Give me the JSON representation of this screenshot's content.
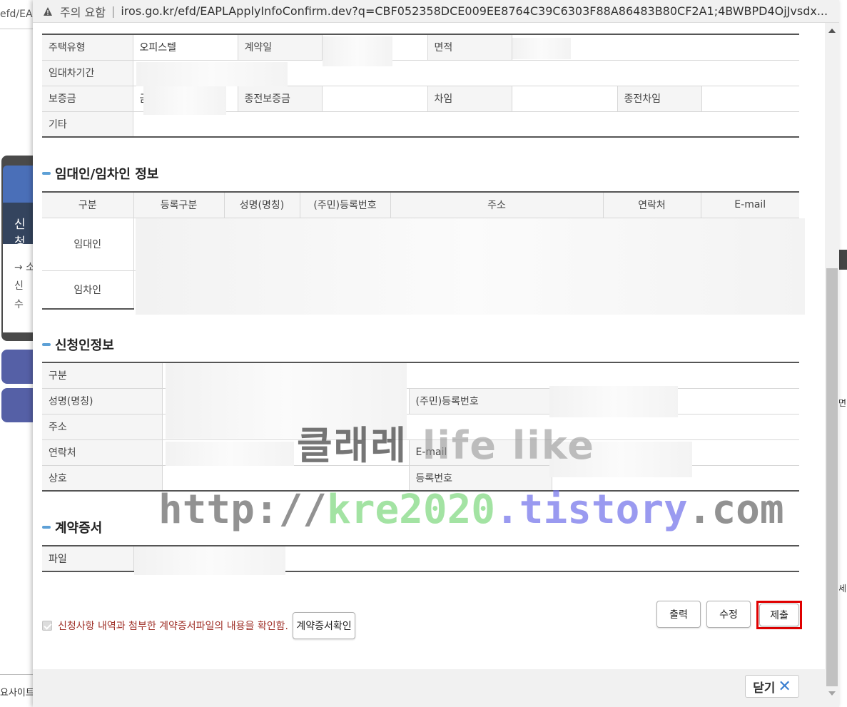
{
  "background": {
    "url_fragment": "efd/EA",
    "side_label": "신청",
    "side_items": [
      "→ 소",
      "신",
      "수"
    ],
    "bottom_text": "요사이트",
    "right_text_1": "면",
    "right_text_2": "세"
  },
  "browser": {
    "warning_text": "주의 요함",
    "url": "iros.go.kr/efd/EAPLApplyInfoConfirm.dev?q=CBF052358DCE009EE8764C39C6303F88A86483B80CF2A1;4BWBPD4OjJvsdx..."
  },
  "contract_table": {
    "housing_type_label": "주택유형",
    "housing_type_value": "오피스텔",
    "contract_date_label": "계약일",
    "area_label": "면적",
    "lease_period_label": "임대차기간",
    "deposit_label": "보증금",
    "deposit_value_partial": "금",
    "prev_deposit_label": "종전보증금",
    "rent_label": "차임",
    "prev_rent_label": "종전차임",
    "etc_label": "기타"
  },
  "parties": {
    "title": "임대인/임차인 정보",
    "headers": [
      "구분",
      "등록구분",
      "성명(명칭)",
      "(주민)등록번호",
      "주소",
      "연락처",
      "E-mail"
    ],
    "rows": [
      "임대인",
      "임차인"
    ]
  },
  "applicant": {
    "title": "신청인정보",
    "category_label": "구분",
    "name_label": "성명(명칭)",
    "reg_no_label": "(주민)등록번호",
    "address_label": "주소",
    "phone_label": "연락처",
    "email_label": "E-mail",
    "company_label": "상호",
    "biz_reg_label": "등록번호"
  },
  "contract_doc": {
    "title": "계약증서",
    "file_label": "파일"
  },
  "watermark": {
    "line1_dark": "클래레",
    "line1_light": "life like",
    "line2_a": "http://",
    "line2_b": "kre2020",
    "line2_c": ".tistory",
    "line2_d": ".com"
  },
  "confirm": {
    "text": "신청사항 내역과 첨부한 계약증서파일의 내용을 확인함.",
    "button": "계약증서확인"
  },
  "actions": {
    "print": "출력",
    "edit": "수정",
    "submit": "제출"
  },
  "footer": {
    "close": "닫기"
  },
  "colors": {
    "section_bar": "#5da0d6",
    "highlight": "#e00000",
    "confirm_text": "#a0322a"
  }
}
